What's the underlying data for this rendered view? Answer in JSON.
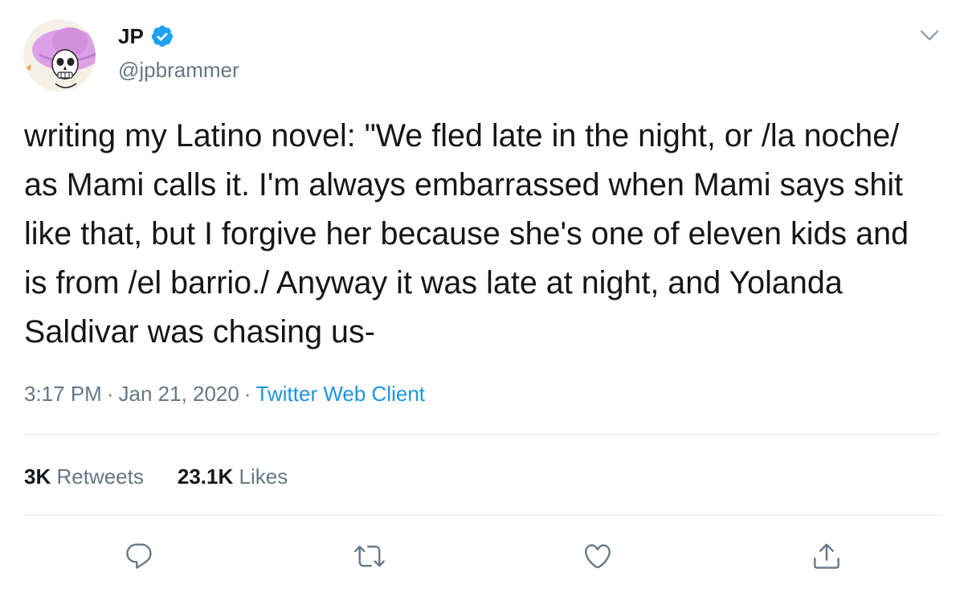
{
  "user": {
    "display_name": "JP",
    "handle": "@jpbrammer",
    "verified": true
  },
  "tweet": {
    "text": "writing my Latino novel: \"We fled late in the night, or /la noche/ as Mami calls it. I'm always embarrassed when Mami says shit like that, but I forgive her because she's one of eleven kids and is from /el barrio./ Anyway it was late at night, and Yolanda Saldivar was chasing us-",
    "time": "3:17 PM",
    "separator": "·",
    "date": "Jan 21, 2020",
    "source": "Twitter Web Client"
  },
  "stats": {
    "retweets_count": "3K",
    "retweets_label": "Retweets",
    "likes_count": "23.1K",
    "likes_label": "Likes"
  },
  "actions": [
    "reply-icon",
    "retweet-icon",
    "like-icon",
    "share-icon"
  ],
  "colors": {
    "text": "#14171a",
    "secondary": "#657786",
    "link": "#1b95e0",
    "verified": "#1da1f2",
    "divider": "#e1e8ed"
  }
}
